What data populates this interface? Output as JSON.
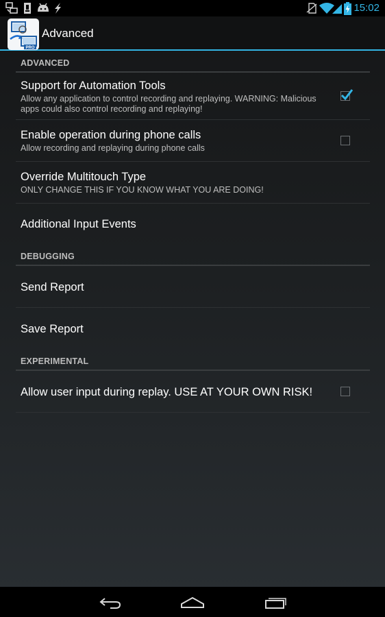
{
  "status_bar": {
    "time": "15:02",
    "left_icons": [
      "notification-app-icon",
      "sd-card-icon",
      "android-debug-icon",
      "flash-icon"
    ],
    "right_icons": [
      "no-sim-icon",
      "wifi-icon",
      "signal-icon",
      "battery-charging-icon"
    ]
  },
  "action_bar": {
    "title": "Advanced",
    "app_icon_badge": "PRO"
  },
  "colors": {
    "accent": "#33b5e5",
    "background": "#1d2022",
    "section_text": "#bdbdbd"
  },
  "sections": {
    "advanced": {
      "header": "ADVANCED",
      "automation": {
        "title": "Support for Automation Tools",
        "summary": "Allow any application to control recording and replaying. WARNING: Malicious apps could also control recording and replaying!",
        "checked": true
      },
      "phone_calls": {
        "title": "Enable operation during phone calls",
        "summary": "Allow recording and replaying during phone calls",
        "checked": false
      },
      "multitouch": {
        "title": "Override Multitouch Type",
        "summary": "ONLY CHANGE THIS IF YOU KNOW WHAT YOU ARE DOING!"
      },
      "input_events": {
        "title": "Additional Input Events"
      }
    },
    "debugging": {
      "header": "DEBUGGING",
      "send_report": {
        "title": "Send Report"
      },
      "save_report": {
        "title": "Save Report"
      }
    },
    "experimental": {
      "header": "EXPERIMENTAL",
      "user_input": {
        "title": "Allow user input during replay. USE AT YOUR OWN RISK!",
        "checked": false
      }
    }
  },
  "nav_bar": {
    "buttons": [
      "back-icon",
      "home-icon",
      "recent-apps-icon"
    ]
  }
}
